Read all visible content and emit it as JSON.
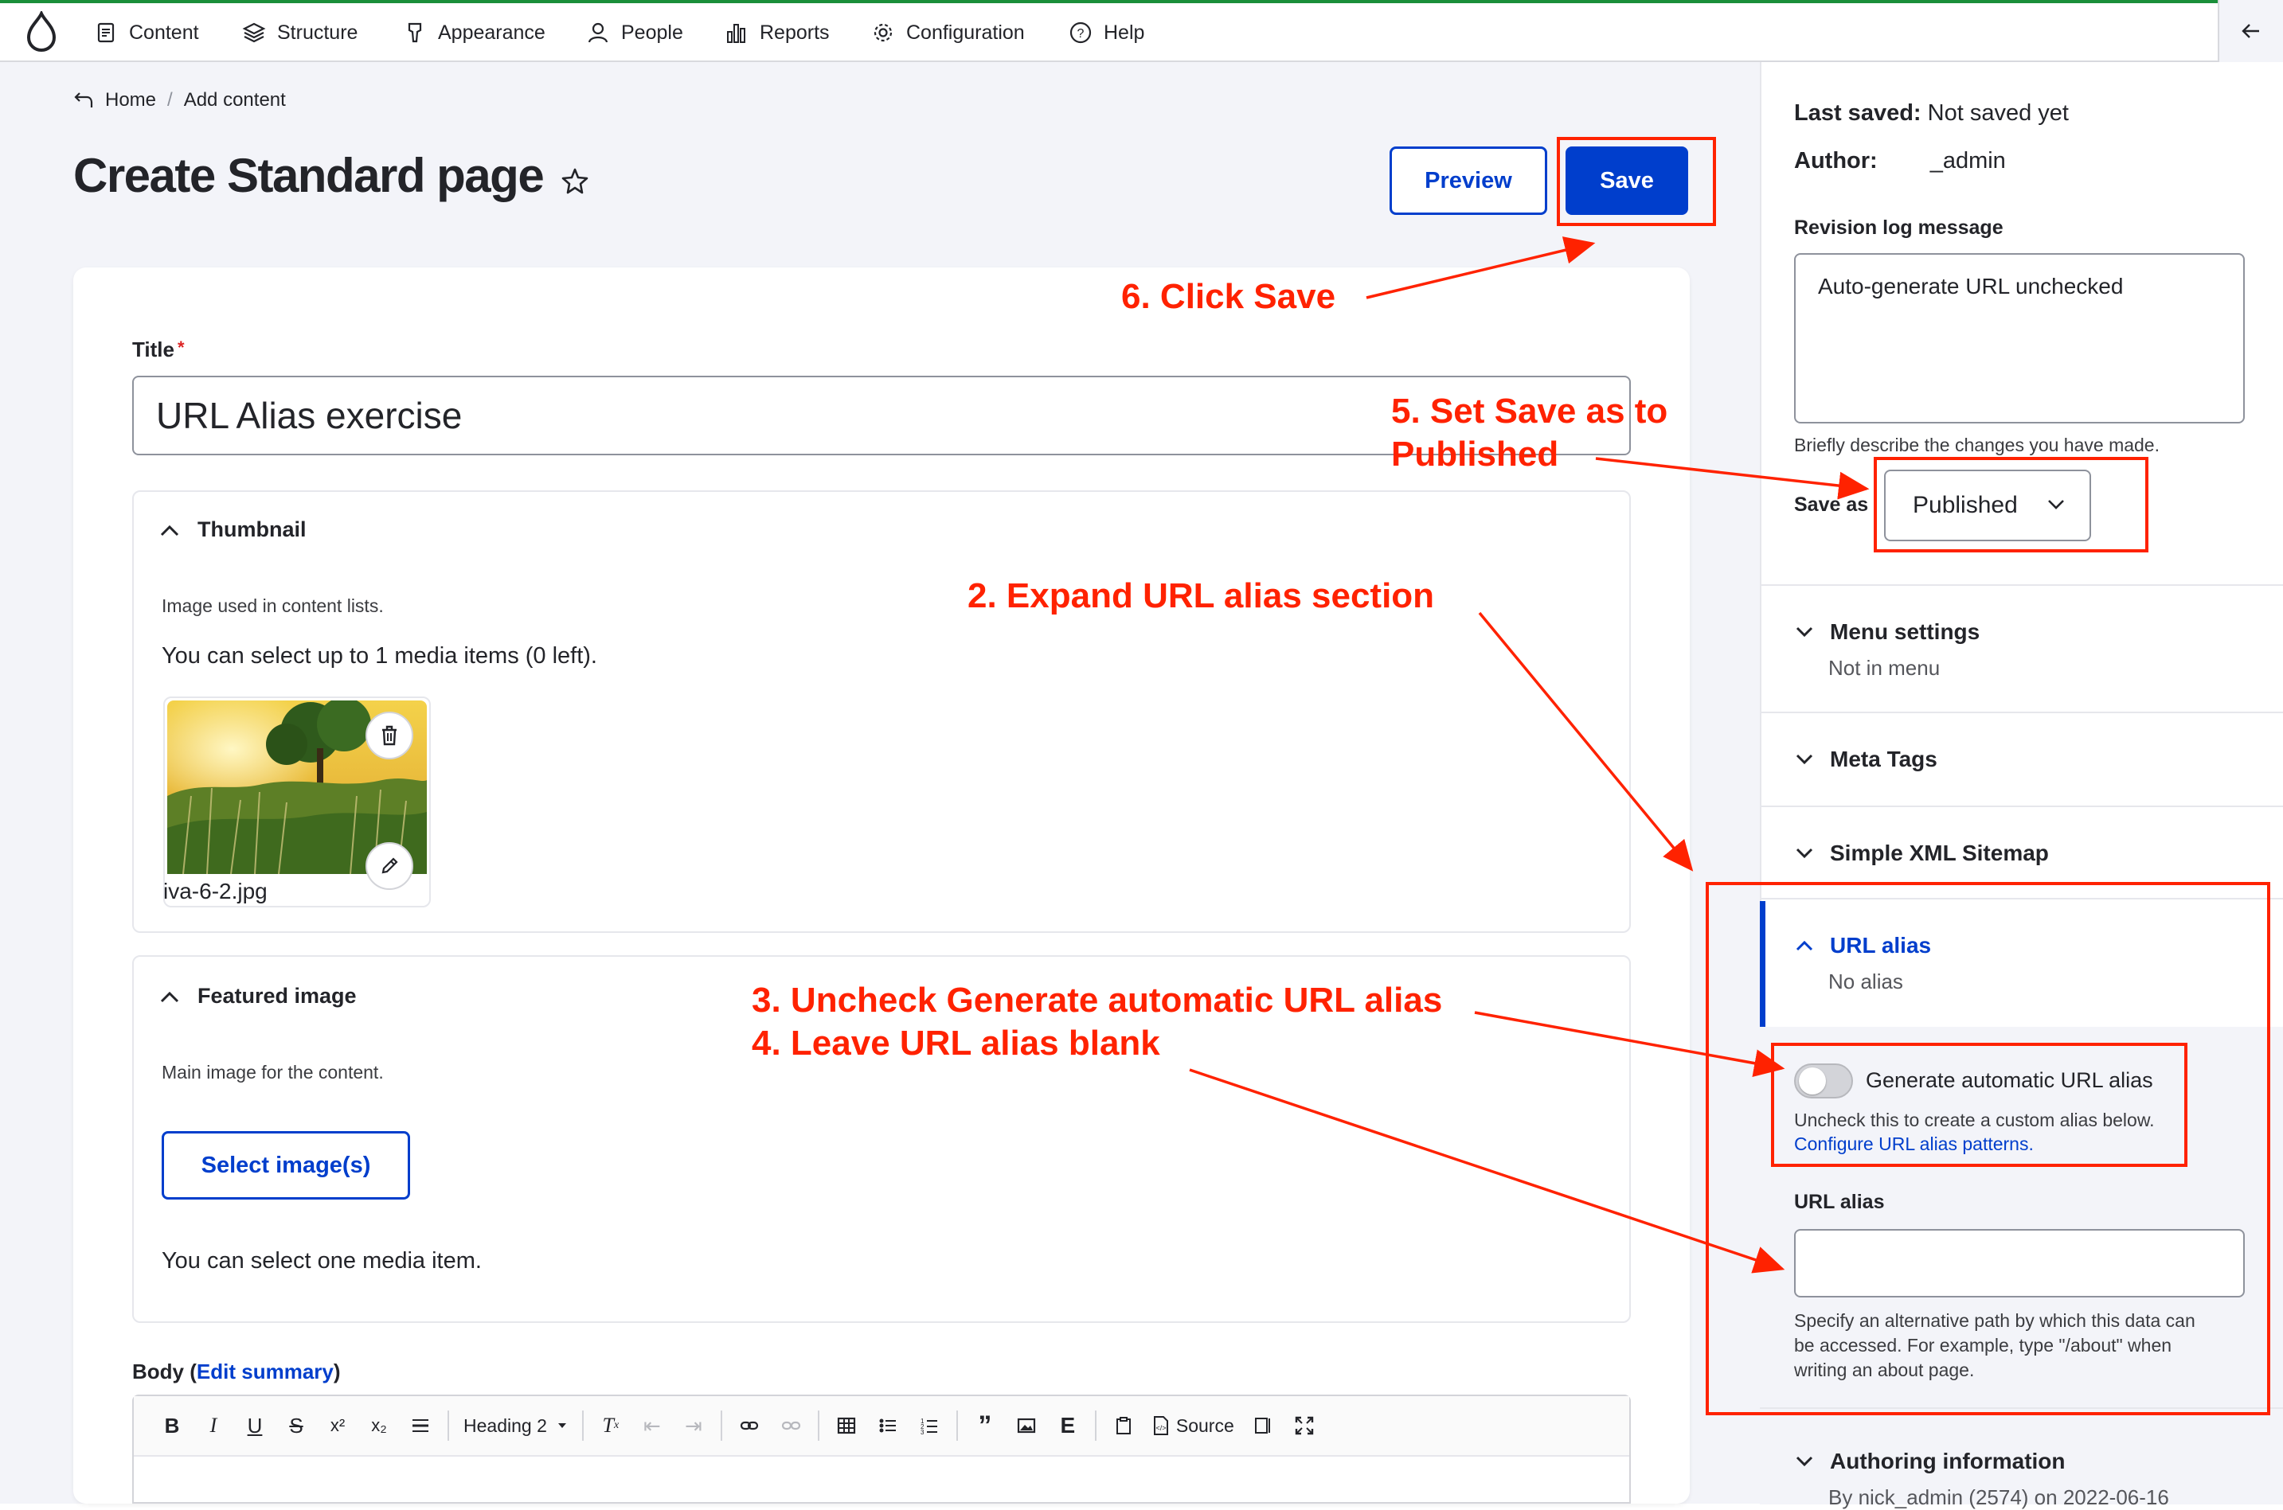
{
  "nav": {
    "items": [
      {
        "label": "Content",
        "icon": "document-icon"
      },
      {
        "label": "Structure",
        "icon": "layers-icon"
      },
      {
        "label": "Appearance",
        "icon": "brush-icon"
      },
      {
        "label": "People",
        "icon": "person-icon"
      },
      {
        "label": "Reports",
        "icon": "bar-chart-icon"
      },
      {
        "label": "Configuration",
        "icon": "gear-icon"
      },
      {
        "label": "Help",
        "icon": "help-icon"
      }
    ]
  },
  "breadcrumb": {
    "home": "Home",
    "separator": "/",
    "current": "Add content"
  },
  "page": {
    "title": "Create Standard page",
    "preview_label": "Preview",
    "save_label": "Save"
  },
  "form": {
    "title_label": "Title",
    "required_mark": "*",
    "title_value": "URL Alias exercise",
    "thumbnail": {
      "heading": "Thumbnail",
      "description": "Image used in content lists.",
      "limit_text": "You can select up to 1 media items (0 left).",
      "filename": "iva-6-2.jpg"
    },
    "featured": {
      "heading": "Featured image",
      "description": "Main image for the content.",
      "button_label": "Select image(s)",
      "note": "You can select one media item."
    },
    "body": {
      "label": "Body",
      "paren_open": "(",
      "edit_summary": "Edit summary",
      "paren_close": ")",
      "heading_select": "Heading 2",
      "source_label": "Source"
    }
  },
  "sidebar": {
    "last_saved_label": "Last saved:",
    "last_saved_value": "Not saved yet",
    "author_label": "Author:",
    "author_value": "_admin",
    "revision_label": "Revision log message",
    "revision_value": "Auto-generate URL unchecked",
    "revision_help": "Briefly describe the changes you have made.",
    "save_as_label": "Save as",
    "save_as_value": "Published",
    "menu_settings": {
      "title": "Menu settings",
      "summary": "Not in menu"
    },
    "meta_tags": {
      "title": "Meta Tags"
    },
    "sitemap": {
      "title": "Simple XML Sitemap"
    },
    "url_alias": {
      "title": "URL alias",
      "summary": "No alias",
      "toggle_label": "Generate automatic URL alias",
      "toggle_help": "Uncheck this to create a custom alias below.",
      "patterns_link": "Configure URL alias patterns.",
      "field_label": "URL alias",
      "field_help_1": "Specify an alternative path by which this data can",
      "field_help_2": "be accessed. For example, type \"/about\" when",
      "field_help_3": "writing an about page."
    },
    "authoring": {
      "title": "Authoring information",
      "summary": "By nick_admin (2574) on 2022-06-16"
    }
  },
  "annotations": {
    "step6": "6. Click Save",
    "step5_line1": "5. Set Save as to",
    "step5_line2": "Published",
    "step2": "2. Expand URL alias section",
    "step3": "3. Uncheck Generate automatic URL alias",
    "step4": "4. Leave URL alias blank",
    "color": "#ff2200"
  },
  "colors": {
    "accent": "#003ecc",
    "annotation": "#ff2200",
    "required": "#dc2323"
  }
}
